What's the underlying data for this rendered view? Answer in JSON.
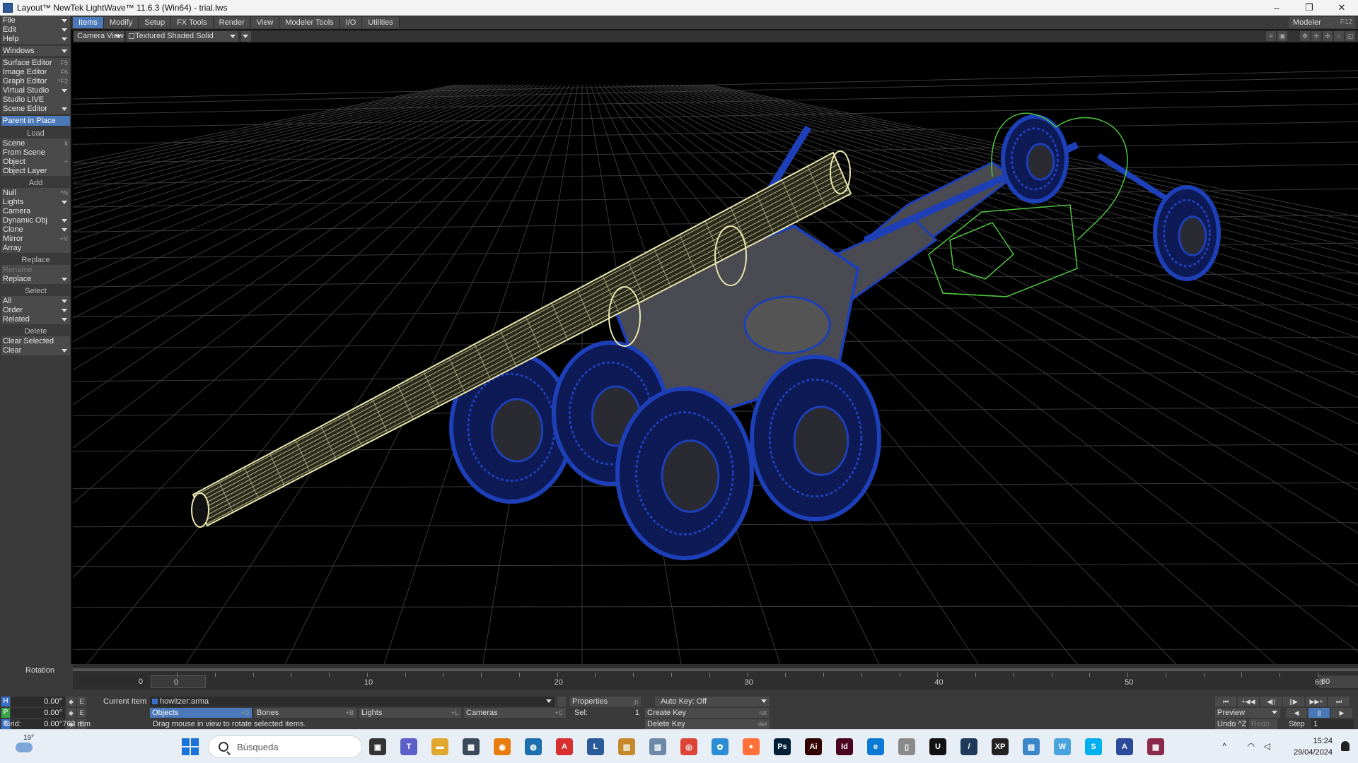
{
  "window": {
    "title": "Layout™ NewTek LightWave™ 11.6.3 (Win64) - trial.lws",
    "minimize": "–",
    "maximize": "❐",
    "close": "✕"
  },
  "menu_tabs": [
    {
      "label": "Items",
      "active": true
    },
    {
      "label": "Modify"
    },
    {
      "label": "Setup"
    },
    {
      "label": "FX Tools"
    },
    {
      "label": "Render"
    },
    {
      "label": "View"
    },
    {
      "label": "Modeler Tools"
    },
    {
      "label": "I/O"
    },
    {
      "label": "Utilities"
    }
  ],
  "modeler_button": {
    "label": "Modeler",
    "shortcut": "F12"
  },
  "left_panel": {
    "top": [
      {
        "label": "File"
      },
      {
        "label": "Edit"
      },
      {
        "label": "Help"
      }
    ],
    "windows": "Windows",
    "editors": [
      {
        "label": "Surface Editor",
        "shortcut": "F5"
      },
      {
        "label": "Image Editor",
        "shortcut": "F6"
      },
      {
        "label": "Graph Editor",
        "shortcut": "^F2"
      },
      {
        "label": "Virtual Studio"
      },
      {
        "label": "Studio LIVE"
      },
      {
        "label": "Scene Editor"
      }
    ],
    "parent_in_place": "Parent in Place",
    "load_heading": "Load",
    "load": [
      {
        "label": "Scene",
        "shortcut": "k"
      },
      {
        "label": "From Scene"
      },
      {
        "label": "Object",
        "shortcut": "+"
      },
      {
        "label": "Object Layer"
      }
    ],
    "add_heading": "Add",
    "add": [
      {
        "label": "Null",
        "shortcut": "^N"
      },
      {
        "label": "Lights"
      },
      {
        "label": "Camera"
      },
      {
        "label": "Dynamic Obj"
      },
      {
        "label": "Clone"
      },
      {
        "label": "Mirror",
        "shortcut": "+V"
      },
      {
        "label": "Array"
      }
    ],
    "replace_heading": "Replace",
    "replace": [
      {
        "label": "Rename"
      },
      {
        "label": "Replace"
      }
    ],
    "select_heading": "Select",
    "select": [
      {
        "label": "All"
      },
      {
        "label": "Order"
      },
      {
        "label": "Related"
      }
    ],
    "delete_heading": "Delete",
    "delete": [
      {
        "label": "Clear Selected"
      },
      {
        "label": "Clear"
      }
    ]
  },
  "viewport": {
    "view_type": "Camera View",
    "render_mode": "Textured Shaded Solid Wireframe",
    "colors": {
      "grid": "#3a3a3a",
      "barrel": "#e8e6b0",
      "body": "#1d3fb8",
      "body_dark": "#4a4a52",
      "camera": "#4fc53f"
    }
  },
  "timeline": {
    "labels": [
      "0",
      "10",
      "20",
      "30",
      "40",
      "50",
      "60"
    ],
    "current_frame": "0",
    "end_frame": "60"
  },
  "bottom": {
    "rotation_label": "Rotation",
    "axes": [
      {
        "letter": "H",
        "value": "0.00°",
        "color": "#3a6fc9"
      },
      {
        "letter": "P",
        "value": "0.00°",
        "color": "#3aa34a"
      },
      {
        "letter": "B",
        "value": "0.00°",
        "color": "#3a6fc9"
      }
    ],
    "envelope_btn": "E",
    "grid_label": "Grid:",
    "grid_value": "763 mm",
    "frame_field": "0",
    "current_item_label": "Current Item",
    "current_item": "howitzer:arma",
    "properties": {
      "label": "Properties",
      "shortcut": "p"
    },
    "auto_key": "Auto Key: Off",
    "item_types": [
      {
        "label": "Objects",
        "shortcut": "+O",
        "active": true
      },
      {
        "label": "Bones",
        "shortcut": "+B"
      },
      {
        "label": "Lights",
        "shortcut": "+L"
      },
      {
        "label": "Cameras",
        "shortcut": "+C"
      }
    ],
    "sel_label": "Sel:",
    "sel_value": "1",
    "create_key": {
      "label": "Create Key",
      "shortcut": "ret"
    },
    "delete_key": {
      "label": "Delete Key",
      "shortcut": "del"
    },
    "status": "Drag mouse in view to rotate selected items.",
    "preview": "Preview",
    "undo": "Undo ^Z",
    "redo": "Redo",
    "step_label": "Step",
    "step_value": "1"
  },
  "taskbar": {
    "temperature": "19°",
    "search_placeholder": "Búsqueda",
    "time": "15:24",
    "date": "29/04/2024",
    "apps": [
      {
        "name": "task-view-icon",
        "glyph": "▣",
        "color": "#333333"
      },
      {
        "name": "teams-icon",
        "glyph": "T",
        "color": "#5b5fc7"
      },
      {
        "name": "file-explorer-icon",
        "glyph": "▬",
        "color": "#e0a82e"
      },
      {
        "name": "calculator-icon",
        "glyph": "▦",
        "color": "#3a4a5a"
      },
      {
        "name": "blender-icon",
        "glyph": "◉",
        "color": "#e87d0d"
      },
      {
        "name": "app-globe-icon",
        "glyph": "◍",
        "color": "#1b6fae"
      },
      {
        "name": "acrobat-icon",
        "glyph": "A",
        "color": "#d8302f"
      },
      {
        "name": "lightwave-icon",
        "glyph": "L",
        "color": "#2a5a9a"
      },
      {
        "name": "image-app-icon",
        "glyph": "▤",
        "color": "#c5882a"
      },
      {
        "name": "graph-app-icon",
        "glyph": "▥",
        "color": "#6c8aa8"
      },
      {
        "name": "chrome-icon",
        "glyph": "◎",
        "color": "#db4437"
      },
      {
        "name": "photos-icon",
        "glyph": "✿",
        "color": "#2b8dd4"
      },
      {
        "name": "firefox-icon",
        "glyph": "●",
        "color": "#ff7139"
      },
      {
        "name": "photoshop-icon",
        "glyph": "Ps",
        "color": "#001e36"
      },
      {
        "name": "illustrator-icon",
        "glyph": "Ai",
        "color": "#330000"
      },
      {
        "name": "indesign-icon",
        "glyph": "Id",
        "color": "#49021f"
      },
      {
        "name": "edge-icon",
        "glyph": "e",
        "color": "#0c7ad4"
      },
      {
        "name": "notepad-icon",
        "glyph": "▯",
        "color": "#8a8a8a"
      },
      {
        "name": "unreal-icon",
        "glyph": "U",
        "color": "#111111"
      },
      {
        "name": "pen-app-icon",
        "glyph": "/",
        "color": "#1f3a5a"
      },
      {
        "name": "xp-pen-icon",
        "glyph": "XP",
        "color": "#222222"
      },
      {
        "name": "paint-icon",
        "glyph": "▧",
        "color": "#3a87c8"
      },
      {
        "name": "w-app-icon",
        "glyph": "W",
        "color": "#4aa3df"
      },
      {
        "name": "skype-icon",
        "glyph": "S",
        "color": "#00aff0"
      },
      {
        "name": "a-app-icon",
        "glyph": "A",
        "color": "#2b4a9a"
      },
      {
        "name": "winrar-icon",
        "glyph": "▦",
        "color": "#8a2a4a"
      }
    ]
  }
}
